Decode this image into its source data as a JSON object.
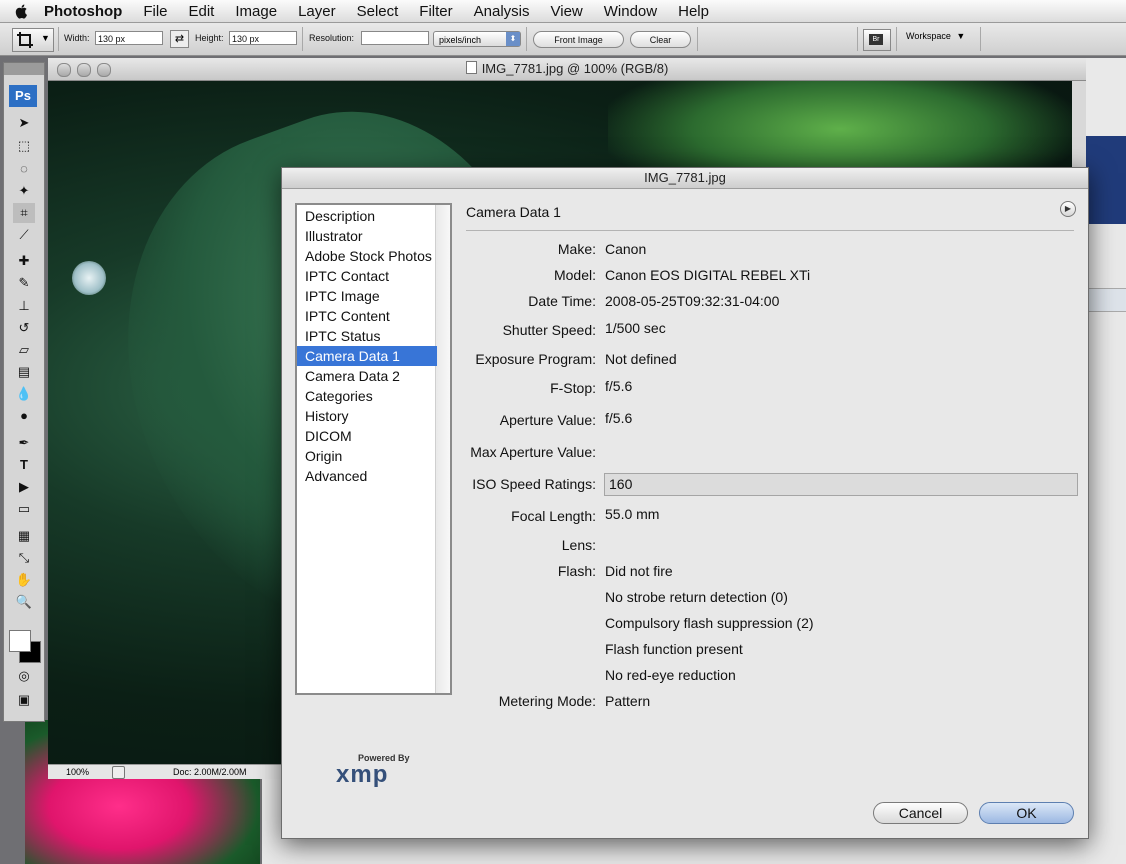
{
  "menubar": {
    "app_name": "Photoshop",
    "items": [
      "File",
      "Edit",
      "Image",
      "Layer",
      "Select",
      "Filter",
      "Analysis",
      "View",
      "Window",
      "Help"
    ]
  },
  "options_bar": {
    "width_label": "Width:",
    "width_value": "130 px",
    "height_label": "Height:",
    "height_value": "130 px",
    "resolution_label": "Resolution:",
    "resolution_value": "",
    "resolution_unit": "pixels/inch",
    "front_image_label": "Front Image",
    "clear_label": "Clear",
    "workspace_label": "Workspace"
  },
  "toolbox": {
    "logo": "Ps"
  },
  "document": {
    "title": "IMG_7781.jpg @ 100% (RGB/8)",
    "zoom": "100%",
    "doc_size": "Doc: 2.00M/2.00M"
  },
  "dialog": {
    "title": "IMG_7781.jpg",
    "categories": [
      "Description",
      "Illustrator",
      "Adobe Stock Photos",
      "IPTC Contact",
      "IPTC Image",
      "IPTC Content",
      "IPTC Status",
      "Camera Data 1",
      "Camera Data 2",
      "Categories",
      "History",
      "DICOM",
      "Origin",
      "Advanced"
    ],
    "selected_category": "Camera Data 1",
    "pane_title": "Camera Data 1",
    "fields": {
      "make_label": "Make:",
      "make": "Canon",
      "model_label": "Model:",
      "model": "Canon EOS DIGITAL REBEL XTi",
      "datetime_label": "Date Time:",
      "datetime": "2008-05-25T09:32:31-04:00",
      "shutter_label": "Shutter Speed:",
      "shutter": "1/500 sec",
      "exposure_label": "Exposure Program:",
      "exposure": "Not defined",
      "fstop_label": "F-Stop:",
      "fstop": "f/5.6",
      "aperture_label": "Aperture Value:",
      "aperture": "f/5.6",
      "max_aperture_label": "Max Aperture Value:",
      "max_aperture": "",
      "iso_label": "ISO Speed Ratings:",
      "iso": "160",
      "focal_label": "Focal Length:",
      "focal": "55.0 mm",
      "lens_label": "Lens:",
      "lens": "",
      "flash_label": "Flash:",
      "flash_lines": [
        "Did not fire",
        "No strobe return detection (0)",
        "Compulsory flash suppression (2)",
        "Flash function present",
        "No red-eye reduction"
      ],
      "metering_label": "Metering Mode:",
      "metering": "Pattern"
    },
    "powered_by": "Powered By",
    "xmp_logo": "xmp",
    "cancel_label": "Cancel",
    "ok_label": "OK"
  }
}
